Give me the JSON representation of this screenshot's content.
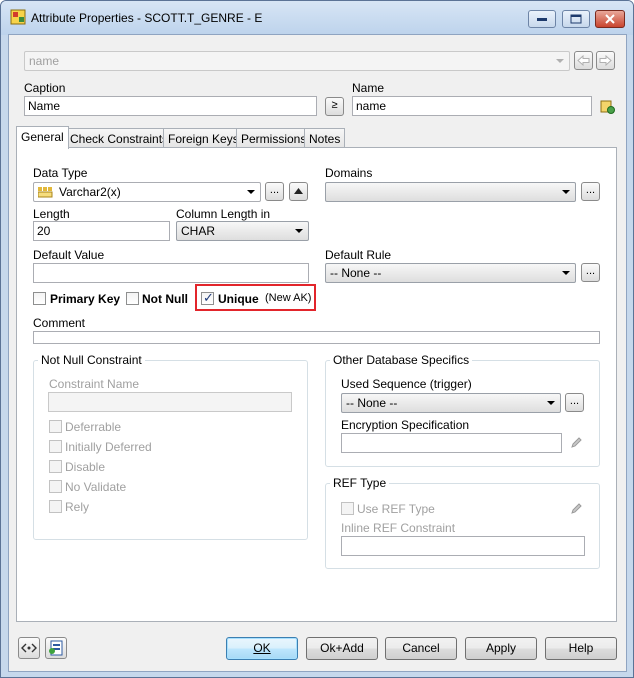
{
  "window": {
    "title": "Attribute Properties - SCOTT.T_GENRE - E",
    "controls": {
      "minimize": "minimize-icon",
      "maximize": "maximize-icon",
      "close": "close-icon"
    }
  },
  "header": {
    "selector_value": "name",
    "caption_label": "Caption",
    "caption_value": "Name",
    "copy_button": "≥",
    "name_label": "Name",
    "name_value": "name"
  },
  "tabs": [
    "General",
    "Check Constraints",
    "Foreign Keys",
    "Permissions",
    "Notes"
  ],
  "general": {
    "data_type_label": "Data Type",
    "data_type_value": "Varchar2(x)",
    "ellipsis": "...",
    "domains_label": "Domains",
    "domains_value": "",
    "length_label": "Length",
    "length_value": "20",
    "column_length_label": "Column Length in",
    "column_length_value": "CHAR",
    "default_value_label": "Default Value",
    "default_value_value": "",
    "default_rule_label": "Default Rule",
    "default_rule_value": "-- None --",
    "primary_key_label": "Primary Key",
    "not_null_label": "Not Null",
    "unique_label": "Unique",
    "unique_note": "(New AK)",
    "comment_label": "Comment",
    "not_null_constraint": {
      "title": "Not Null Constraint",
      "constraint_name_label": "Constraint Name",
      "deferrable": "Deferrable",
      "initially_deferred": "Initially Deferred",
      "disable": "Disable",
      "no_validate": "No Validate",
      "rely": "Rely"
    },
    "other_db": {
      "title": "Other Database Specifics",
      "used_sequence_label": "Used Sequence (trigger)",
      "used_sequence_value": "-- None --",
      "encryption_label": "Encryption Specification"
    },
    "ref_type": {
      "title": "REF Type",
      "use_ref_type": "Use REF Type",
      "inline_ref_label": "Inline REF Constraint"
    }
  },
  "footer": {
    "ok": "OK",
    "ok_add": "Ok+Add",
    "cancel": "Cancel",
    "apply": "Apply",
    "help": "Help"
  },
  "colors": {
    "highlight": "#e2252b",
    "window_frame": "#c6d8ec"
  }
}
